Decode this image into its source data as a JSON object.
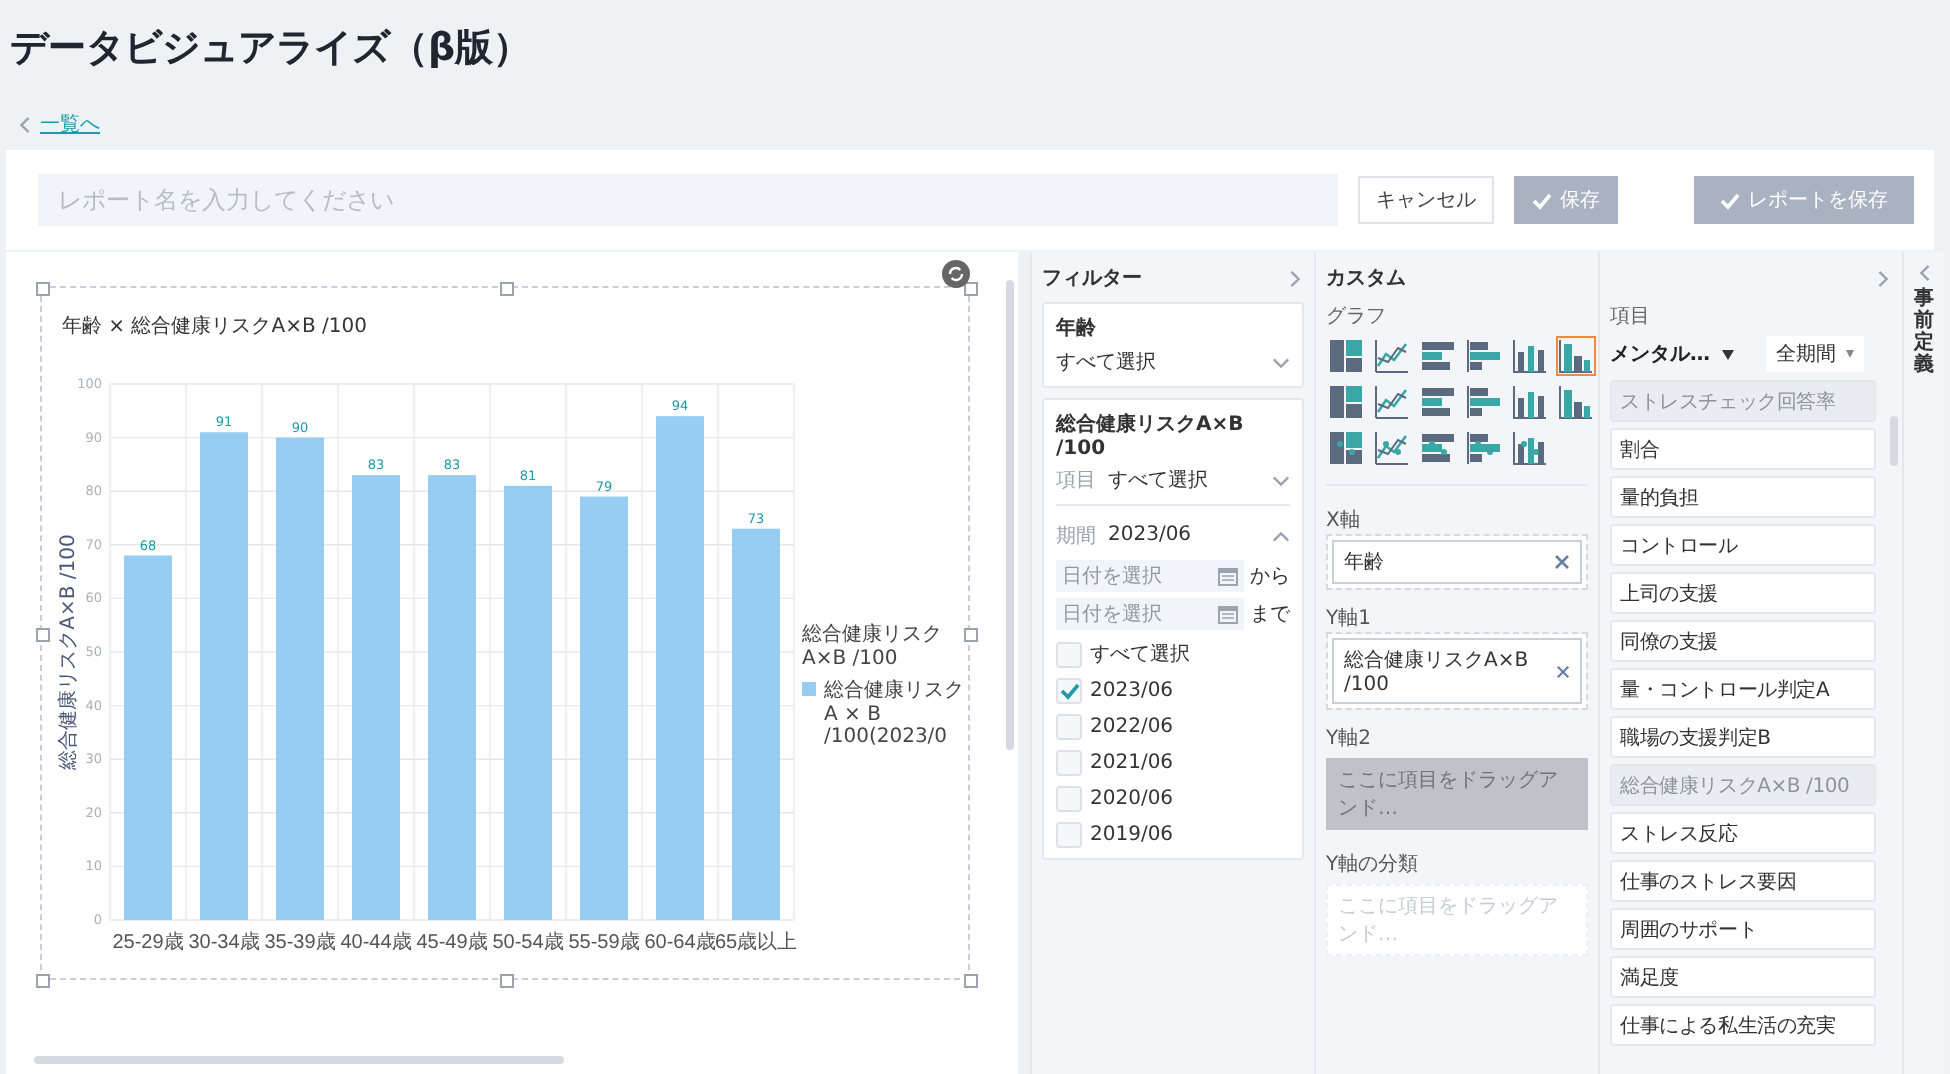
{
  "page": {
    "title": "データビジュアライズ（β版）",
    "back_link": "一覧へ"
  },
  "toolbar": {
    "report_name": {
      "placeholder": "レポート名を入力してください"
    },
    "buttons": [
      {
        "label": "キャンセル",
        "disabled": false,
        "kind": "plain"
      },
      {
        "label": "保存",
        "disabled": true,
        "kind": "check"
      },
      {
        "label": "レポートを保存",
        "disabled": true,
        "kind": "check"
      }
    ]
  },
  "chart_panel": {
    "legend_title": "総合健康リスクA×B /100",
    "chart_data": {
      "type": "bar",
      "title": "年齢 × 総合健康リスクA×B /100",
      "ylabel": "総合健康リスクA×B /100",
      "categories": [
        "25-29歳",
        "30-34歳",
        "35-39歳",
        "40-44歳",
        "45-49歳",
        "50-54歳",
        "55-59歳",
        "60-64歳",
        "65歳以上"
      ],
      "series": [
        {
          "name": "総合健康リスク A × B /100(2023/0",
          "color": "#97cdf2",
          "values": [
            68,
            91,
            90,
            83,
            83,
            81,
            79,
            94,
            73
          ]
        }
      ],
      "grid": true,
      "ylim": [
        0,
        100
      ],
      "yticks": [
        0,
        10,
        20,
        30,
        40,
        50,
        60,
        70,
        80,
        90,
        100
      ],
      "data_labels": true
    }
  },
  "filter": {
    "title": "フィルター",
    "age": {
      "label": "年齢",
      "value": "すべて選択"
    },
    "metric": {
      "label": "総合健康リスクA×B /100",
      "item_label": "項目",
      "item_value": "すべて選択",
      "period_label": "期間",
      "period_value": "2023/06",
      "expanded": true,
      "date_from": {
        "placeholder": "日付を選択",
        "suffix": "から"
      },
      "date_to": {
        "placeholder": "日付を選択",
        "suffix": "まで"
      },
      "options": [
        {
          "label": "すべて選択",
          "checked": false
        },
        {
          "label": "2023/06",
          "checked": true
        },
        {
          "label": "2022/06",
          "checked": false
        },
        {
          "label": "2021/06",
          "checked": false
        },
        {
          "label": "2020/06",
          "checked": false
        },
        {
          "label": "2019/06",
          "checked": false
        }
      ]
    }
  },
  "custom": {
    "title": "カスタム",
    "graph_label": "グラフ",
    "graph_types": [
      {
        "selected": false
      },
      {
        "selected": false
      },
      {
        "selected": false
      },
      {
        "selected": false
      },
      {
        "selected": false
      },
      {
        "selected": true
      },
      {
        "selected": false
      },
      {
        "selected": false
      },
      {
        "selected": false
      },
      {
        "selected": false
      },
      {
        "selected": false
      },
      {
        "selected": false
      },
      {
        "selected": false
      },
      {
        "selected": false
      },
      {
        "selected": false
      },
      {
        "selected": false
      },
      {
        "selected": false
      }
    ],
    "axes": [
      {
        "kind": "filled",
        "label": "X軸",
        "value": "年齢"
      },
      {
        "kind": "filled",
        "label": "Y軸1",
        "value": "総合健康リスクA×B /100"
      },
      {
        "kind": "empty",
        "label": "Y軸2",
        "placeholder": "ここに項目をドラッグアンド…",
        "disabled": true
      },
      {
        "kind": "empty",
        "label": "Y軸の分類",
        "placeholder": "ここに項目をドラッグアンド…",
        "disabled": false
      }
    ]
  },
  "items_panel": {
    "title": "項目",
    "category": "メンタル…",
    "period": "全期間",
    "items": [
      {
        "label": "ストレスチェック回答率",
        "disabled": true
      },
      {
        "label": "割合",
        "disabled": false
      },
      {
        "label": "量的負担",
        "disabled": false
      },
      {
        "label": "コントロール",
        "disabled": false
      },
      {
        "label": "上司の支援",
        "disabled": false
      },
      {
        "label": "同僚の支援",
        "disabled": false
      },
      {
        "label": "量・コントロール判定A",
        "disabled": false
      },
      {
        "label": "職場の支援判定B",
        "disabled": false
      },
      {
        "label": "総合健康リスクA×B /100",
        "disabled": true
      },
      {
        "label": "ストレス反応",
        "disabled": false
      },
      {
        "label": "仕事のストレス要因",
        "disabled": false
      },
      {
        "label": "周囲のサポート",
        "disabled": false
      },
      {
        "label": "満足度",
        "disabled": false
      },
      {
        "label": "仕事による私生活の充実",
        "disabled": false
      }
    ]
  },
  "side_tab": {
    "label": "事前定義"
  }
}
